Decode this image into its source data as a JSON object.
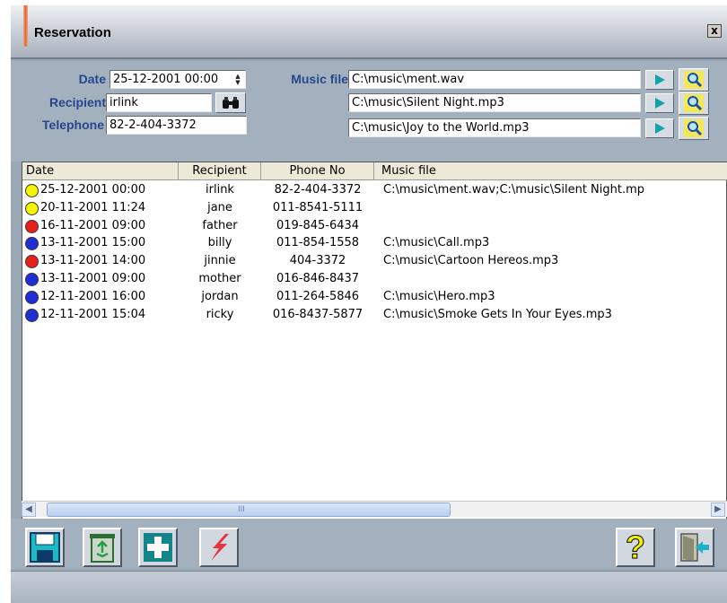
{
  "window": {
    "title": "Reservation",
    "close_label": "x"
  },
  "form": {
    "date_label": "Date",
    "date_value": "25-12-2001 00:00",
    "recipient_label": "Recipient",
    "recipient_value": "irlink",
    "telephone_label": "Telephone",
    "telephone_value": "82-2-404-3372",
    "music_label": "Music file",
    "music_files": [
      "C:\\music\\ment.wav",
      "C:\\music\\Silent Night.mp3",
      "C:\\music\\Joy to the World.mp3"
    ]
  },
  "grid": {
    "columns": [
      "Date",
      "Recipient",
      "Phone No",
      "Music file"
    ],
    "rows": [
      {
        "status": "yellow",
        "date": "25-12-2001 00:00",
        "recipient": "irlink",
        "phone": "82-2-404-3372",
        "music": "C:\\music\\ment.wav;C:\\music\\Silent Night.mp"
      },
      {
        "status": "yellow",
        "date": "20-11-2001 11:24",
        "recipient": "jane",
        "phone": "011-8541-5111",
        "music": ""
      },
      {
        "status": "red",
        "date": "16-11-2001 09:00",
        "recipient": "father",
        "phone": "019-845-6434",
        "music": ""
      },
      {
        "status": "blue",
        "date": "13-11-2001 15:00",
        "recipient": "billy",
        "phone": "011-854-1558",
        "music": "C:\\music\\Call.mp3"
      },
      {
        "status": "red",
        "date": "13-11-2001 14:00",
        "recipient": "jinnie",
        "phone": "404-3372",
        "music": "C:\\music\\Cartoon Hereos.mp3"
      },
      {
        "status": "blue",
        "date": "13-11-2001 09:00",
        "recipient": "mother",
        "phone": "016-846-8437",
        "music": ""
      },
      {
        "status": "blue",
        "date": "12-11-2001 16:00",
        "recipient": "jordan",
        "phone": "011-264-5846",
        "music": "C:\\music\\Hero.mp3"
      },
      {
        "status": "blue",
        "date": "12-11-2001 15:04",
        "recipient": "ricky",
        "phone": "016-8437-5877",
        "music": "C:\\music\\Smoke Gets In Your Eyes.mp3"
      }
    ]
  },
  "scrollbar": {
    "thumb_label": "III"
  },
  "status_colors": {
    "yellow": "#f5f500",
    "red": "#e8201a",
    "blue": "#1f2fd4"
  },
  "toolbar": {
    "left_icons": [
      "save-icon",
      "recycle-bin-icon",
      "add-icon",
      "lightning-icon"
    ],
    "right_icons": [
      "help-icon",
      "exit-door-icon"
    ],
    "help_glyph": "?"
  }
}
